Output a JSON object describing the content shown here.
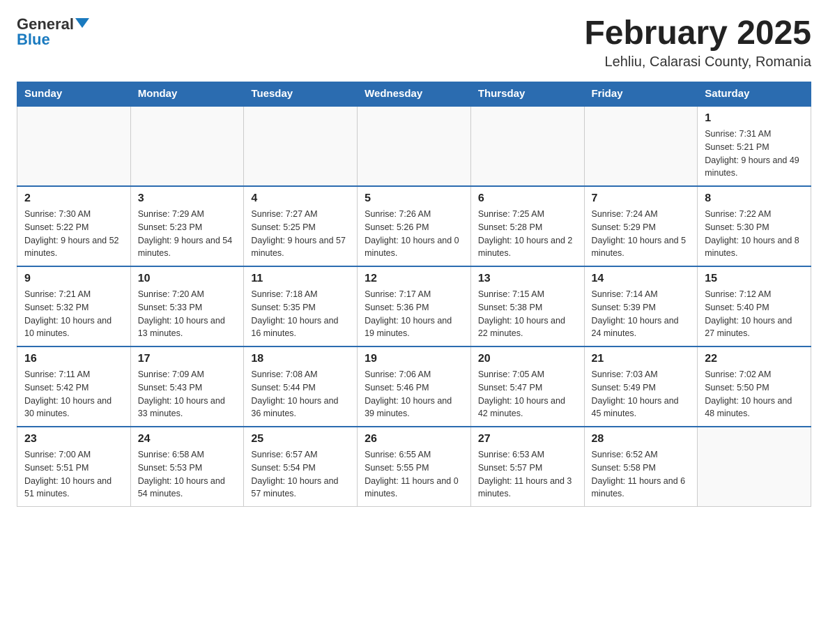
{
  "header": {
    "logo_general": "General",
    "logo_blue": "Blue",
    "month_year": "February 2025",
    "location": "Lehliu, Calarasi County, Romania"
  },
  "weekdays": [
    "Sunday",
    "Monday",
    "Tuesday",
    "Wednesday",
    "Thursday",
    "Friday",
    "Saturday"
  ],
  "weeks": [
    [
      {
        "day": "",
        "info": ""
      },
      {
        "day": "",
        "info": ""
      },
      {
        "day": "",
        "info": ""
      },
      {
        "day": "",
        "info": ""
      },
      {
        "day": "",
        "info": ""
      },
      {
        "day": "",
        "info": ""
      },
      {
        "day": "1",
        "info": "Sunrise: 7:31 AM\nSunset: 5:21 PM\nDaylight: 9 hours and 49 minutes."
      }
    ],
    [
      {
        "day": "2",
        "info": "Sunrise: 7:30 AM\nSunset: 5:22 PM\nDaylight: 9 hours and 52 minutes."
      },
      {
        "day": "3",
        "info": "Sunrise: 7:29 AM\nSunset: 5:23 PM\nDaylight: 9 hours and 54 minutes."
      },
      {
        "day": "4",
        "info": "Sunrise: 7:27 AM\nSunset: 5:25 PM\nDaylight: 9 hours and 57 minutes."
      },
      {
        "day": "5",
        "info": "Sunrise: 7:26 AM\nSunset: 5:26 PM\nDaylight: 10 hours and 0 minutes."
      },
      {
        "day": "6",
        "info": "Sunrise: 7:25 AM\nSunset: 5:28 PM\nDaylight: 10 hours and 2 minutes."
      },
      {
        "day": "7",
        "info": "Sunrise: 7:24 AM\nSunset: 5:29 PM\nDaylight: 10 hours and 5 minutes."
      },
      {
        "day": "8",
        "info": "Sunrise: 7:22 AM\nSunset: 5:30 PM\nDaylight: 10 hours and 8 minutes."
      }
    ],
    [
      {
        "day": "9",
        "info": "Sunrise: 7:21 AM\nSunset: 5:32 PM\nDaylight: 10 hours and 10 minutes."
      },
      {
        "day": "10",
        "info": "Sunrise: 7:20 AM\nSunset: 5:33 PM\nDaylight: 10 hours and 13 minutes."
      },
      {
        "day": "11",
        "info": "Sunrise: 7:18 AM\nSunset: 5:35 PM\nDaylight: 10 hours and 16 minutes."
      },
      {
        "day": "12",
        "info": "Sunrise: 7:17 AM\nSunset: 5:36 PM\nDaylight: 10 hours and 19 minutes."
      },
      {
        "day": "13",
        "info": "Sunrise: 7:15 AM\nSunset: 5:38 PM\nDaylight: 10 hours and 22 minutes."
      },
      {
        "day": "14",
        "info": "Sunrise: 7:14 AM\nSunset: 5:39 PM\nDaylight: 10 hours and 24 minutes."
      },
      {
        "day": "15",
        "info": "Sunrise: 7:12 AM\nSunset: 5:40 PM\nDaylight: 10 hours and 27 minutes."
      }
    ],
    [
      {
        "day": "16",
        "info": "Sunrise: 7:11 AM\nSunset: 5:42 PM\nDaylight: 10 hours and 30 minutes."
      },
      {
        "day": "17",
        "info": "Sunrise: 7:09 AM\nSunset: 5:43 PM\nDaylight: 10 hours and 33 minutes."
      },
      {
        "day": "18",
        "info": "Sunrise: 7:08 AM\nSunset: 5:44 PM\nDaylight: 10 hours and 36 minutes."
      },
      {
        "day": "19",
        "info": "Sunrise: 7:06 AM\nSunset: 5:46 PM\nDaylight: 10 hours and 39 minutes."
      },
      {
        "day": "20",
        "info": "Sunrise: 7:05 AM\nSunset: 5:47 PM\nDaylight: 10 hours and 42 minutes."
      },
      {
        "day": "21",
        "info": "Sunrise: 7:03 AM\nSunset: 5:49 PM\nDaylight: 10 hours and 45 minutes."
      },
      {
        "day": "22",
        "info": "Sunrise: 7:02 AM\nSunset: 5:50 PM\nDaylight: 10 hours and 48 minutes."
      }
    ],
    [
      {
        "day": "23",
        "info": "Sunrise: 7:00 AM\nSunset: 5:51 PM\nDaylight: 10 hours and 51 minutes."
      },
      {
        "day": "24",
        "info": "Sunrise: 6:58 AM\nSunset: 5:53 PM\nDaylight: 10 hours and 54 minutes."
      },
      {
        "day": "25",
        "info": "Sunrise: 6:57 AM\nSunset: 5:54 PM\nDaylight: 10 hours and 57 minutes."
      },
      {
        "day": "26",
        "info": "Sunrise: 6:55 AM\nSunset: 5:55 PM\nDaylight: 11 hours and 0 minutes."
      },
      {
        "day": "27",
        "info": "Sunrise: 6:53 AM\nSunset: 5:57 PM\nDaylight: 11 hours and 3 minutes."
      },
      {
        "day": "28",
        "info": "Sunrise: 6:52 AM\nSunset: 5:58 PM\nDaylight: 11 hours and 6 minutes."
      },
      {
        "day": "",
        "info": ""
      }
    ]
  ]
}
